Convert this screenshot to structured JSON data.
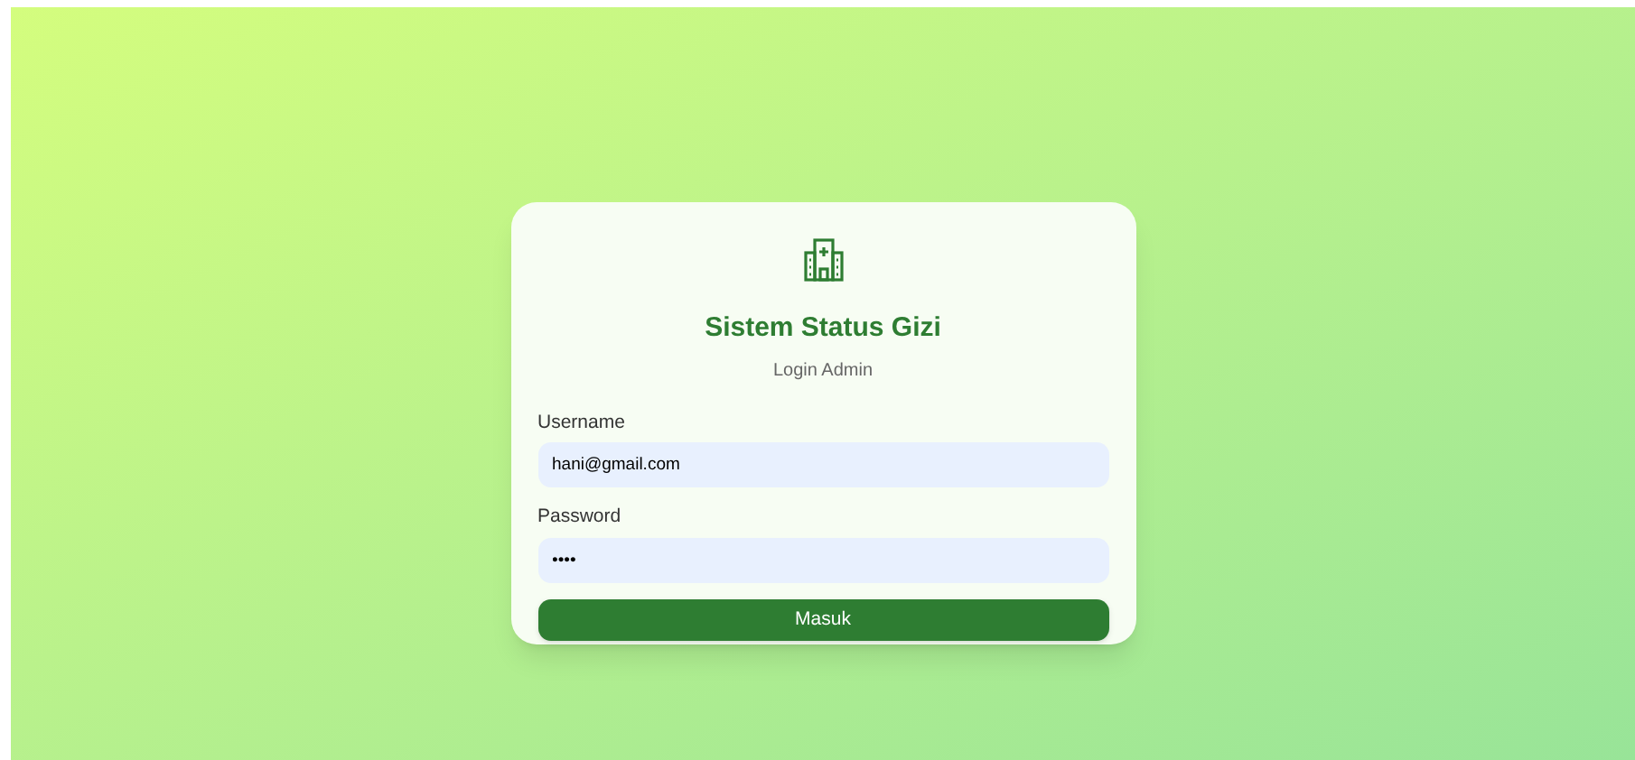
{
  "card": {
    "title": "Sistem Status Gizi",
    "subtitle": "Login Admin"
  },
  "fields": [
    {
      "label": "Username",
      "value": "hani@gmail.com"
    },
    {
      "label": "Password",
      "value": "••••"
    }
  ],
  "submit_button": "Masuk"
}
